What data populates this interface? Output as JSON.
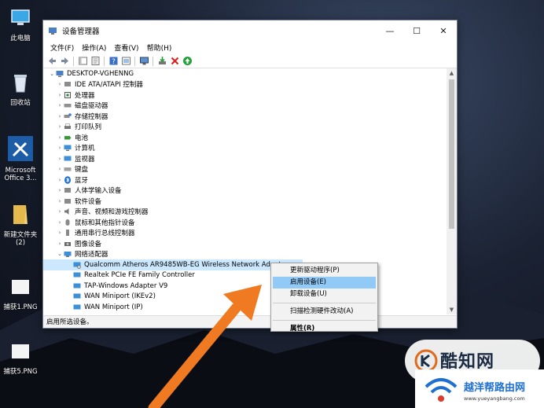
{
  "desktop": {
    "icons": [
      {
        "label": "此电脑",
        "icon": "computer-icon"
      },
      {
        "label": "回收站",
        "icon": "recycle-bin-icon"
      },
      {
        "label": "Microsoft Office 3...",
        "icon": "office-tools-icon"
      },
      {
        "label": "新建文件夹 (2)",
        "icon": "folder-icon"
      },
      {
        "label": "捕获1.PNG",
        "icon": "image-file-icon"
      },
      {
        "label": "捕获5.PNG",
        "icon": "image-file-icon"
      }
    ]
  },
  "window": {
    "title": "设备管理器",
    "controls": {
      "minimize": "—",
      "maximize": "☐",
      "close": "✕"
    },
    "menu": [
      "文件(F)",
      "操作(A)",
      "查看(V)",
      "帮助(H)"
    ],
    "root": "DESKTOP-VGHENNG",
    "categories": [
      "IDE ATA/ATAPI 控制器",
      "处理器",
      "磁盘驱动器",
      "存储控制器",
      "打印队列",
      "电池",
      "计算机",
      "监视器",
      "键盘",
      "蓝牙",
      "人体学输入设备",
      "软件设备",
      "声音、视频和游戏控制器",
      "鼠标和其他指针设备",
      "通用串行总线控制器",
      "图像设备",
      "网络适配器"
    ],
    "network_adapters": [
      "Qualcomm Atheros AR9485WB-EG Wireless Network Adapt",
      "Realtek PCIe FE Family Controller",
      "TAP-Windows Adapter V9",
      "WAN Miniport (IKEv2)",
      "WAN Miniport (IP)"
    ],
    "status": "启用所选设备。"
  },
  "context_menu": {
    "items": [
      "更新驱动程序(P)",
      "启用设备(E)",
      "卸载设备(U)",
      "扫描检测硬件改动(A)",
      "属性(R)"
    ]
  },
  "watermarks": {
    "site1": "酷知网",
    "site2_name": "越洋帮路由网",
    "site2_url": "www.yueyangbang.com"
  },
  "colors": {
    "selection": "#cce8ff",
    "menu_highlight": "#91c9f7",
    "arrow": "#f07a22"
  }
}
